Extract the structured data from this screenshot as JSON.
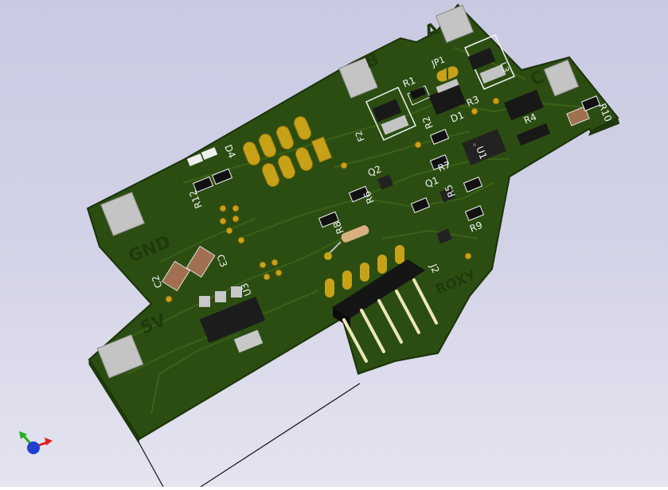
{
  "viewer": {
    "background_top": "#c9c9e2",
    "background_bottom": "#e4e4f0",
    "board_color": "#2b4d12",
    "board_edge_color": "#1a3208",
    "trace_color": "#3d6418",
    "silk_color": "#f2f2f2",
    "pad_color": "#c7a118",
    "pin_color": "#ece7b6"
  },
  "silkscreen": {
    "pad_labels": {
      "a": "A",
      "b": "B",
      "c": "C",
      "gnd": "GND",
      "v5": "5V"
    },
    "designators": {
      "jp1": "JP1",
      "r1": "R1",
      "r2": "R2",
      "r3": "R3",
      "r4": "R4",
      "r5": "R5",
      "r6": "R6",
      "r7": "R7",
      "r8": "R8",
      "r9": "R9",
      "r10": "R10",
      "r12": "R12",
      "d1": "D1",
      "d4": "D4",
      "q1": "Q1",
      "q2": "Q2",
      "u1": "U1",
      "u3": "U3",
      "l3": "L3",
      "f2": "F2",
      "c2": "C2",
      "c3": "C3",
      "j2": "J2"
    },
    "brand": "ROXY"
  },
  "axes_widget": {
    "x_color": "#e02020",
    "y_color": "#20b020",
    "z_color": "#2040d0"
  }
}
